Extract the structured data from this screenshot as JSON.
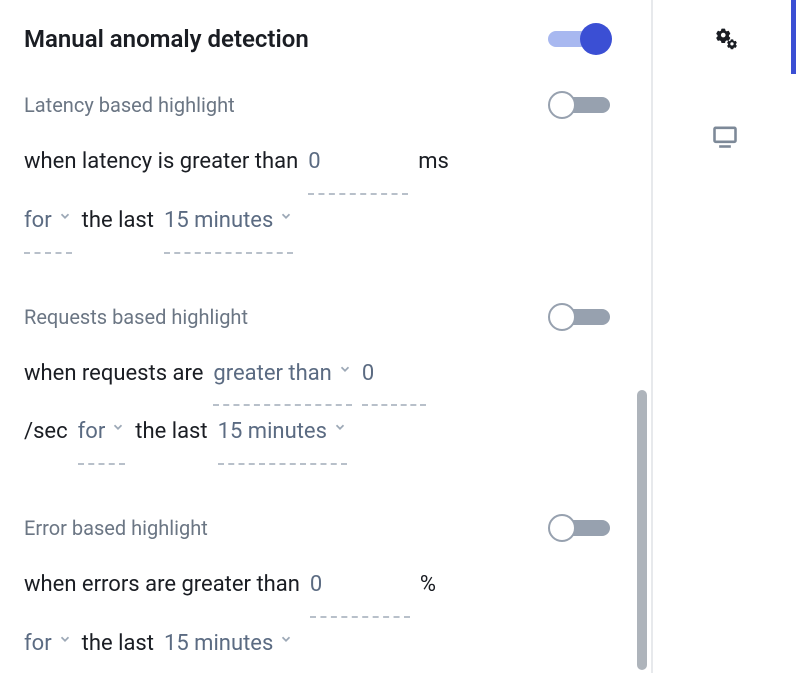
{
  "main": {
    "title": "Manual anomaly detection",
    "master_toggle": true,
    "latency": {
      "heading": "Latency based highlight",
      "toggle": false,
      "prefix": "when latency is greater than",
      "value": "0",
      "unit": "ms",
      "for_label": "for",
      "last_label": "the last",
      "window": "15 minutes"
    },
    "requests": {
      "heading": "Requests based highlight",
      "toggle": false,
      "prefix": "when requests are",
      "comparator": "greater than",
      "value": "0",
      "per_unit": "/sec",
      "for_label": "for",
      "last_label": "the last",
      "window": "15 minutes"
    },
    "errors": {
      "heading": "Error based highlight",
      "toggle": false,
      "prefix": "when errors are greater than",
      "value": "0",
      "unit": "%",
      "for_label": "for",
      "last_label": "the last",
      "window": "15 minutes"
    }
  }
}
